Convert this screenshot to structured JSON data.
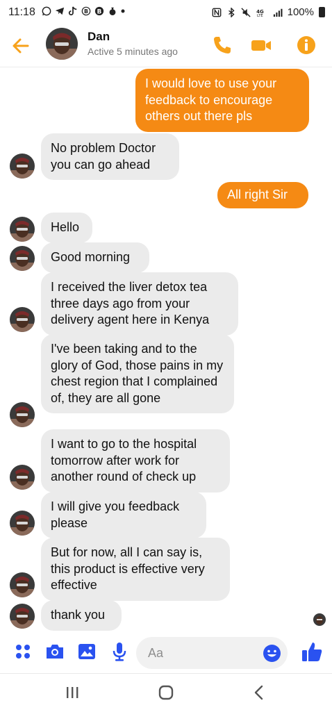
{
  "status_bar": {
    "time": "11:18",
    "battery": "100%",
    "left_icons": [
      "whatsapp-icon",
      "telegram-icon",
      "tiktok-icon",
      "b-icon",
      "bitcoin-icon",
      "moneybag-icon",
      "dot-icon"
    ],
    "right_icons": [
      "nfc-icon",
      "bluetooth-icon",
      "mute-icon",
      "4g-icon",
      "signal-icon",
      "battery-icon"
    ]
  },
  "header": {
    "name": "Dan",
    "status": "Active 5 minutes ago",
    "accent": "#f7a21b"
  },
  "messages": [
    {
      "dir": "out",
      "text": "I would love to use your feedback to encourage others out there pls"
    },
    {
      "dir": "in",
      "text": "No problem Doctor you can go ahead"
    },
    {
      "dir": "out",
      "text": "All right Sir"
    },
    {
      "dir": "in",
      "text": "Hello"
    },
    {
      "dir": "in",
      "text": "Good morning"
    },
    {
      "dir": "in",
      "text": "I received the liver detox tea three days ago from your delivery agent here in Kenya"
    },
    {
      "dir": "in",
      "text": "I've been taking and to the glory of God, those pains in my chest region that I complained of, they are all gone"
    },
    {
      "dir": "in",
      "text": "I want to go to the hospital tomorrow after work for another round of check up"
    },
    {
      "dir": "in",
      "text": "I will give you feedback please"
    },
    {
      "dir": "in",
      "text": "But for now, all I can say is, this product is effective very effective"
    },
    {
      "dir": "in",
      "text": "thank you"
    }
  ],
  "composer": {
    "placeholder": "Aa",
    "value": "",
    "icons": [
      "grid-menu-icon",
      "camera-icon",
      "image-icon",
      "microphone-icon",
      "emoji-icon",
      "like-icon"
    ],
    "accent": "#2a52f0"
  },
  "colors": {
    "outgoing_bubble": "#f58a14",
    "incoming_bubble": "#ebebeb"
  }
}
